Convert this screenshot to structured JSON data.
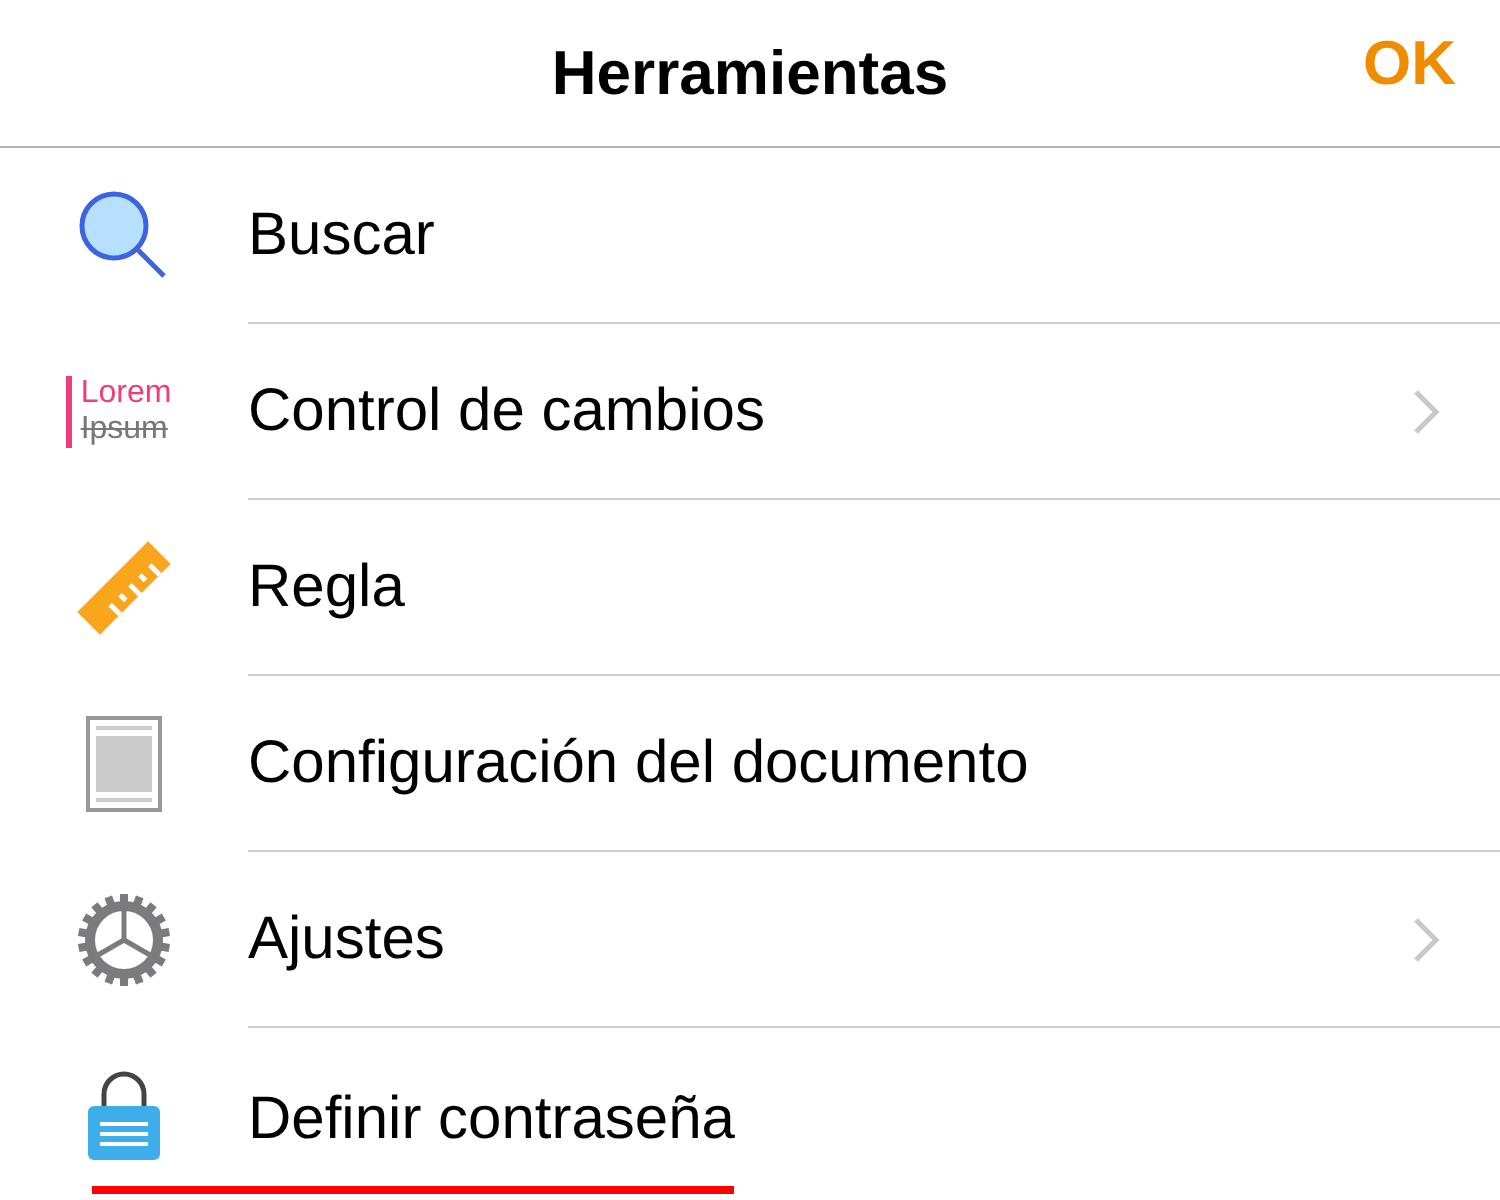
{
  "header": {
    "title": "Herramientas",
    "done": "OK"
  },
  "items": [
    {
      "kind": "search",
      "label": "Buscar",
      "chevron": false,
      "underlined": false
    },
    {
      "kind": "track",
      "label": "Control de cambios",
      "icon_text": [
        "Lorem",
        "Ipsum"
      ],
      "chevron": true,
      "underlined": false
    },
    {
      "kind": "ruler",
      "label": "Regla",
      "chevron": false,
      "underlined": false
    },
    {
      "kind": "page",
      "label": "Configuración del documento",
      "chevron": false,
      "underlined": false
    },
    {
      "kind": "gear",
      "label": "Ajustes",
      "chevron": true,
      "underlined": false
    },
    {
      "kind": "lock",
      "label": "Definir contraseña",
      "chevron": false,
      "underlined": true
    }
  ]
}
